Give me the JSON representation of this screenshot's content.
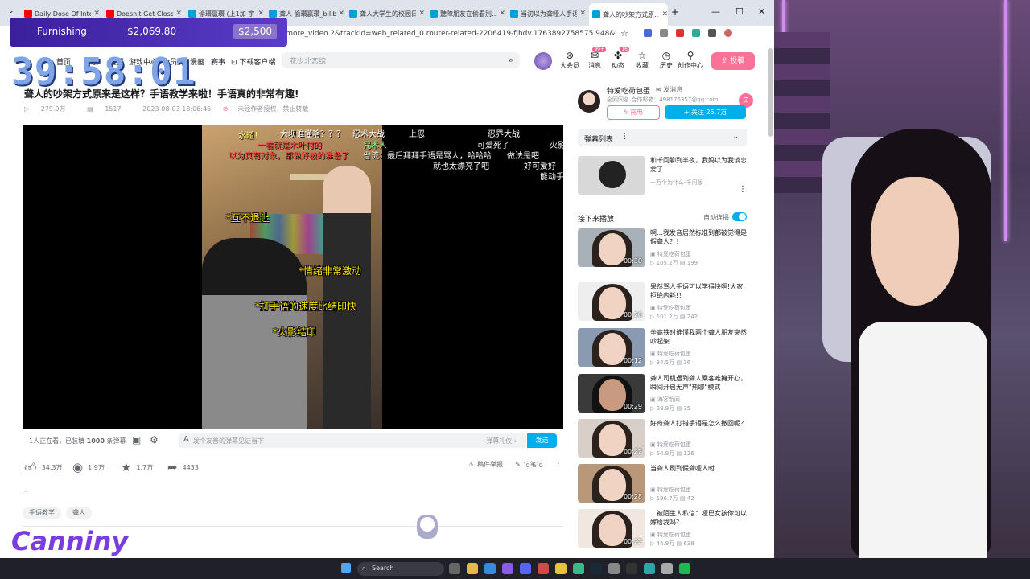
{
  "browser": {
    "tabs": [
      {
        "label": "Daily Dose Of Intern",
        "color": "#ff0000"
      },
      {
        "label": "Doesn't Get Closer Th",
        "color": "#ff0000"
      },
      {
        "label": "偷瓚嬴瓚 (上1加 宇…",
        "color": "#00a1d6"
      },
      {
        "label": "聋人 偷瓚嬴瓚_bilibili",
        "color": "#00a1d6"
      },
      {
        "label": "聋人大学生的校园日…",
        "color": "#00a1d6"
      },
      {
        "label": "聽障朋友在偷看別…",
        "color": "#00a1d6"
      },
      {
        "label": "当初以为聋哑人手语…",
        "color": "#00a1d6"
      },
      {
        "label": "聋人的吵架方式原…",
        "color": "#00a1d6"
      }
    ],
    "url": "d_more_video.2&trackid=web_related_0.router-related-2206419-fjhdv.1763892758575.948&vd_source=1632…"
  },
  "overlay": {
    "goal_label": "Furnishing",
    "goal_amount": "$2,069.80",
    "goal_target": "$2,500",
    "timer": "39:58:01",
    "logo": "Canniny"
  },
  "site": {
    "nav": [
      "首页",
      "番剧",
      "直播",
      "游戏中心",
      "会员购",
      "漫画",
      "赛事",
      "下载客户端"
    ],
    "search_placeholder": "花少北恋综",
    "header_icons": [
      {
        "label": "大会员",
        "icon": "vip-icon"
      },
      {
        "label": "消息",
        "icon": "message-icon",
        "badge": "99+"
      },
      {
        "label": "动态",
        "icon": "dynamic-icon",
        "badge": "16"
      },
      {
        "label": "收藏",
        "icon": "star-icon"
      },
      {
        "label": "历史",
        "icon": "history-icon"
      },
      {
        "label": "创作中心",
        "icon": "bulb-icon"
      }
    ],
    "upload": "投稿"
  },
  "video": {
    "title": "聋人的吵架方式原来是这样？手语教学来啦！手语真的非常有趣!",
    "views": "279.9万",
    "danmaku_count": "1517",
    "date": "2023-08-03 18:06:46",
    "copyright": "未经作者授权，禁止转载",
    "subtitles": [
      "*互不退让",
      "*情绪非常激动",
      "*打手语的速度比结印快",
      "*火影结印"
    ],
    "danmaku": [
      "大坝谁懂啥？？？",
      "忍术大战",
      "上忍",
      "忍界大战",
      "一看就是木叶村的",
      "以为真有对象，都做好被的准备了",
      "省流：最后拜拜手语是骂人，哈哈哈",
      "可爱死了",
      "做法是吧",
      "就也太漂亮了吧",
      "好可爱好",
      "能动手",
      "咒术人",
      "火影",
      "水遁！"
    ],
    "watching": "1人正在看，已装填",
    "watching_num": "1000",
    "watching_suffix": "条弹幕",
    "dm_placeholder": "发个友善的弹幕见证当下",
    "dm_gift": "弹幕礼仪 ›",
    "dm_send": "发送",
    "likes": "34.3万",
    "coins": "1.9万",
    "favs": "1.7万",
    "shares": "4433",
    "report": "稿件举报",
    "notes": "记笔记",
    "desc": "-",
    "tags": [
      "手语教学",
      "聋人"
    ]
  },
  "uploader": {
    "name": "特爱吃荷包蛋",
    "message": "发消息",
    "desc": "全网同名 合作邮箱：498176357@qq.com",
    "charge": "充电",
    "follow": "+ 关注 25.7万"
  },
  "sidebar": {
    "danmaku_list": "弹幕列表",
    "ad": {
      "title": "和千问聊到半夜，我妈以为我谈恋爱了",
      "author": "十万个为什么-千问版"
    },
    "next_label": "接下来播放",
    "autoplay": "自动连播",
    "cards": [
      {
        "title": "啊…我发音居然标准到都被觉得是假聋人？！",
        "author": "特爱吃荷包蛋",
        "views": "105.2万",
        "dm": "199",
        "dur": "00:30"
      },
      {
        "title": "果然骂人手语可以学得快啊!大家拒绝内耗!！",
        "author": "特爱吃荷包蛋",
        "views": "101.2万",
        "dm": "242",
        "dur": "00:20"
      },
      {
        "title": "坐高铁时谁懂我两个聋人朋友突然吵起架…",
        "author": "特爱吃荷包蛋",
        "views": "34.5万",
        "dm": "36",
        "dur": "00:12"
      },
      {
        "title": "聋人司机遇到聋人乘客难掩开心，瞬间开启无声\"热聊\"模式",
        "author": "海客新闻",
        "views": "28.9万",
        "dm": "35",
        "dur": "00:29"
      },
      {
        "title": "好奇聋人打错手语是怎么撤回呢？",
        "author": "特爱吃荷包蛋",
        "views": "54.9万",
        "dm": "126",
        "dur": "00:22"
      },
      {
        "title": "当聋人刷到假聋哑人时…",
        "author": "特爱吃荷包蛋",
        "views": "196.7万",
        "dm": "42",
        "dur": "00:28"
      },
      {
        "title": "…被陌生人私信：哑巴女孩你可以嫁给我吗？",
        "author": "特爱吃荷包蛋",
        "views": "46.9万",
        "dm": "638",
        "dur": "00:22"
      }
    ]
  },
  "taskbar": {
    "search": "Search"
  }
}
